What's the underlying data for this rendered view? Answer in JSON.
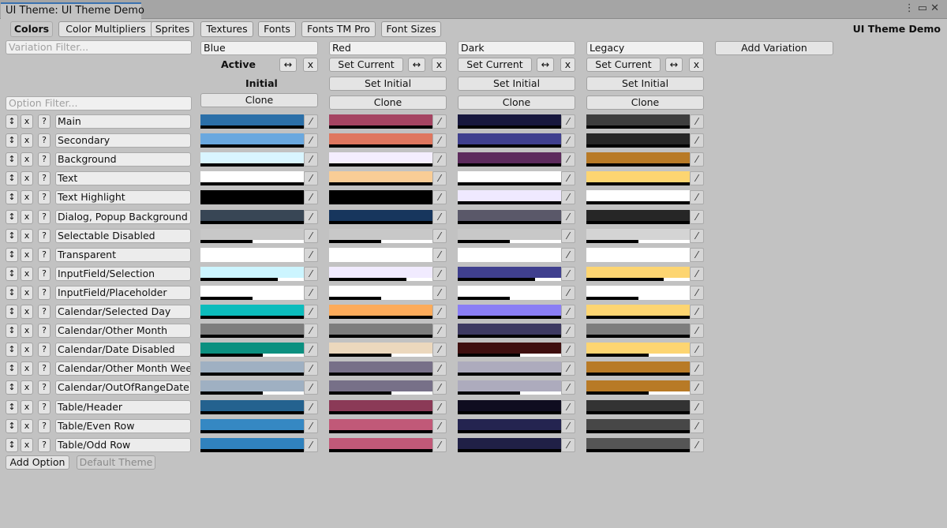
{
  "window": {
    "tab_title": "UI Theme: UI Theme Demo",
    "icons": [
      "more-icon",
      "maximize-icon",
      "close-icon"
    ]
  },
  "header": {
    "title": "UI Theme Demo"
  },
  "tabs": [
    "Colors",
    "Color Multipliers",
    "Sprites",
    "Textures",
    "Fonts",
    "Fonts TM Pro",
    "Font Sizes"
  ],
  "filters": {
    "variation_placeholder": "Variation Filter...",
    "option_placeholder": "Option Filter..."
  },
  "labels": {
    "active": "Active",
    "initial": "Initial",
    "add_variation": "Add Variation",
    "swap": "↔",
    "delete": "x",
    "move": "↕",
    "help": "?"
  },
  "variation_buttons": {
    "set_current": "Set Current",
    "set_initial": "Set Initial",
    "clone": "Clone"
  },
  "variations": [
    {
      "name": "Blue",
      "is_active": true,
      "is_initial": true
    },
    {
      "name": "Red"
    },
    {
      "name": "Dark"
    },
    {
      "name": "Legacy"
    }
  ],
  "options": [
    {
      "name": "Main",
      "colors": [
        "#2b6fa8",
        "#a54462",
        "#17173d",
        "#3d3d3d"
      ],
      "alpha": [
        1,
        1,
        1,
        1
      ]
    },
    {
      "name": "Secondary",
      "colors": [
        "#6aa8df",
        "#df775f",
        "#3f3f8e",
        "#262626"
      ],
      "alpha": [
        1,
        1,
        1,
        1
      ]
    },
    {
      "name": "Background",
      "colors": [
        "#d9f5ff",
        "#f4eefe",
        "#5c2a5c",
        "#b87a26"
      ],
      "alpha": [
        1,
        1,
        1,
        1
      ]
    },
    {
      "name": "Text",
      "colors": [
        "#ffffff",
        "#f9cd96",
        "#ffffff",
        "#fdd571"
      ],
      "alpha": [
        1,
        1,
        1,
        1
      ]
    },
    {
      "name": "Text Highlight",
      "colors": [
        "#000000",
        "#000000",
        "#efe9ff",
        "#ffffff"
      ],
      "alpha": [
        1,
        1,
        1,
        1
      ]
    },
    {
      "name": "Dialog, Popup Background",
      "colors": [
        "#384655",
        "#17365d",
        "#5a5869",
        "#262626"
      ],
      "alpha": [
        1,
        1,
        1,
        1
      ]
    },
    {
      "name": "Selectable Disabled",
      "colors": [
        "#c8c8c8",
        "#c8c8c8",
        "#c8c8c8",
        "#d4d4d4"
      ],
      "alpha": [
        0.5,
        0.5,
        0.5,
        0.5
      ]
    },
    {
      "name": "Transparent",
      "colors": [
        "#ffffff",
        "#ffffff",
        "#ffffff",
        "#ffffff"
      ],
      "alpha": [
        0,
        0,
        0,
        0
      ]
    },
    {
      "name": "InputField/Selection",
      "colors": [
        "#ccf5ff",
        "#f1ebff",
        "#3f3f8e",
        "#fdd571"
      ],
      "alpha": [
        0.75,
        0.75,
        0.75,
        0.75
      ]
    },
    {
      "name": "InputField/Placeholder",
      "colors": [
        "#ffffff",
        "#ffffff",
        "#ffffff",
        "#ffffff"
      ],
      "alpha": [
        0.5,
        0.5,
        0.5,
        0.5
      ]
    },
    {
      "name": "Calendar/Selected Day",
      "colors": [
        "#0cbcbc",
        "#fdab5a",
        "#8a7ef5",
        "#fdd571"
      ],
      "alpha": [
        1,
        1,
        1,
        1
      ]
    },
    {
      "name": "Calendar/Other Month",
      "colors": [
        "#7d7d7d",
        "#7d7d7d",
        "#3e3a62",
        "#7d7d7d"
      ],
      "alpha": [
        1,
        1,
        1,
        1
      ]
    },
    {
      "name": "Calendar/Date Disabled",
      "colors": [
        "#0b9080",
        "#ecd8bd",
        "#3f0f0f",
        "#fdd571"
      ],
      "alpha": [
        0.6,
        0.6,
        0.6,
        0.6
      ]
    },
    {
      "name": "Calendar/Other Month Week",
      "colors": [
        "#9fb0c2",
        "#777088",
        "#adabbd",
        "#b87a26"
      ],
      "alpha": [
        1,
        1,
        1,
        1
      ]
    },
    {
      "name": "Calendar/OutOfRangeDate",
      "colors": [
        "#9fb0c2",
        "#777088",
        "#adabbd",
        "#b87a26"
      ],
      "alpha": [
        0.6,
        0.6,
        0.6,
        0.6
      ]
    },
    {
      "name": "Table/Header",
      "colors": [
        "#24628f",
        "#8b3a57",
        "#0f0d20",
        "#333333"
      ],
      "alpha": [
        1,
        1,
        1,
        1
      ]
    },
    {
      "name": "Table/Even Row",
      "colors": [
        "#3588c3",
        "#c15978",
        "#242450",
        "#474747"
      ],
      "alpha": [
        1,
        1,
        1,
        1
      ]
    },
    {
      "name": "Table/Odd Row",
      "colors": [
        "#3082be",
        "#c15978",
        "#202046",
        "#555555"
      ],
      "alpha": [
        1,
        1,
        1,
        1
      ]
    }
  ],
  "footer": {
    "add_option": "Add Option",
    "default_theme": "Default Theme"
  }
}
